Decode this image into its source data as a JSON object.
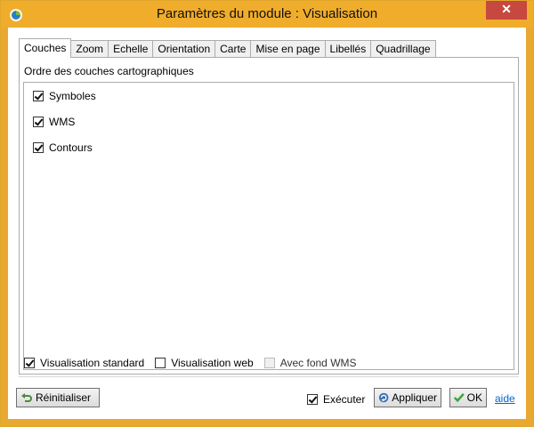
{
  "window": {
    "title": "Paramètres du module : Visualisation",
    "close_symbol": "✕",
    "icon": "app-icon"
  },
  "tabs": [
    {
      "label": "Couches",
      "active": true
    },
    {
      "label": "Zoom",
      "active": false
    },
    {
      "label": "Echelle",
      "active": false
    },
    {
      "label": "Orientation",
      "active": false
    },
    {
      "label": "Carte",
      "active": false
    },
    {
      "label": "Mise en page",
      "active": false
    },
    {
      "label": "Libellés",
      "active": false
    },
    {
      "label": "Quadrillage",
      "active": false
    }
  ],
  "panel": {
    "label": "Ordre des couches cartographiques",
    "layers": [
      {
        "label": "Symboles",
        "checked": true
      },
      {
        "label": "WMS",
        "checked": true
      },
      {
        "label": "Contours",
        "checked": true
      }
    ]
  },
  "options": {
    "standard": {
      "label": "Visualisation standard",
      "checked": true
    },
    "web": {
      "label": "Visualisation web",
      "checked": false
    },
    "wms_bg": {
      "label": "Avec fond WMS",
      "checked": false,
      "disabled": true
    }
  },
  "footer": {
    "reset_label": "Réinitialiser",
    "execute_label": "Exécuter",
    "execute_checked": true,
    "apply_label": "Appliquer",
    "ok_label": "OK",
    "help_label": "aide"
  },
  "colors": {
    "titlebar": "#f0ac2b",
    "close": "#c7483f",
    "link": "#0066cc"
  }
}
